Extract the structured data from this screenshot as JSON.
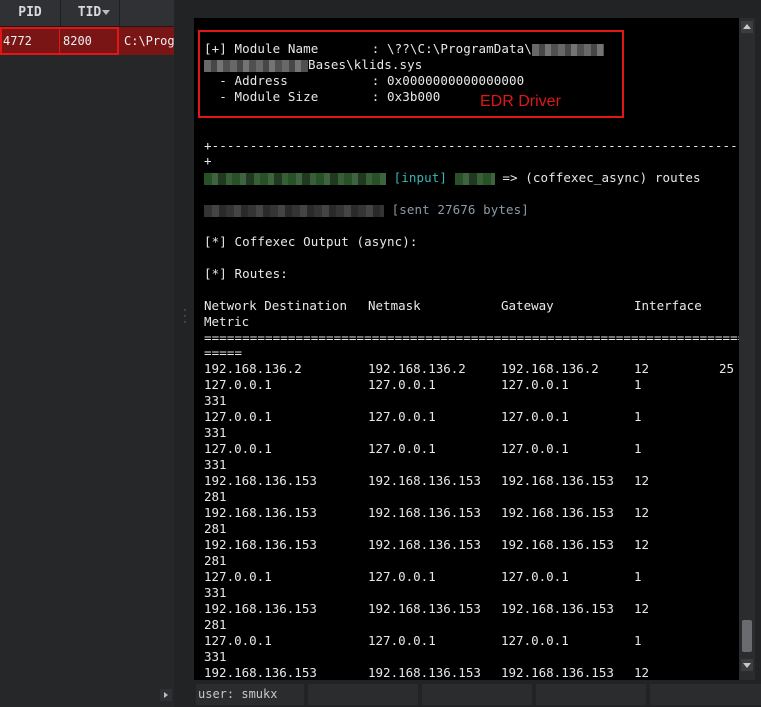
{
  "process_table": {
    "columns": [
      "PID",
      "TID"
    ],
    "row": {
      "pid": "4772",
      "tid": "8200",
      "path": "C:\\Prog"
    }
  },
  "terminal": {
    "module": {
      "name_line": "[+] Module Name       : \\??\\C:\\ProgramData\\",
      "name_line2": "Bases\\klids.sys",
      "address_line": "  - Address           : 0x0000000000000000",
      "size_line": "  - Module Size       : 0x3b000",
      "annotation": "EDR Driver"
    },
    "separator_line": "+---------------------------------------------------------------------",
    "separator_end": "+",
    "input_tag": "[input]",
    "command": "=> (coffexec_async) routes",
    "sent": "[sent 27676 bytes]",
    "coffexec_output": "[*] Coffexec Output (async):",
    "routes_header": "[*] Routes:",
    "table_headers": {
      "destination": "Network Destination",
      "netmask": "Netmask",
      "gateway": "Gateway",
      "interface": "Interface",
      "metric": "Metric"
    },
    "equals_line": "=======================================================================",
    "equals_end": "=====",
    "routes": [
      {
        "dest": "192.168.136.2",
        "mask": "192.168.136.2",
        "gw": "192.168.136.2",
        "iface": "12",
        "metric": "25"
      },
      {
        "dest": "127.0.0.1",
        "mask": "127.0.0.1",
        "gw": "127.0.0.1",
        "iface": "1",
        "metric": "331"
      },
      {
        "dest": "127.0.0.1",
        "mask": "127.0.0.1",
        "gw": "127.0.0.1",
        "iface": "1",
        "metric": "331"
      },
      {
        "dest": "127.0.0.1",
        "mask": "127.0.0.1",
        "gw": "127.0.0.1",
        "iface": "1",
        "metric": "331"
      },
      {
        "dest": "192.168.136.153",
        "mask": "192.168.136.153",
        "gw": "192.168.136.153",
        "iface": "12",
        "metric": "281"
      },
      {
        "dest": "192.168.136.153",
        "mask": "192.168.136.153",
        "gw": "192.168.136.153",
        "iface": "12",
        "metric": "281"
      },
      {
        "dest": "192.168.136.153",
        "mask": "192.168.136.153",
        "gw": "192.168.136.153",
        "iface": "12",
        "metric": "281"
      },
      {
        "dest": "127.0.0.1",
        "mask": "127.0.0.1",
        "gw": "127.0.0.1",
        "iface": "1",
        "metric": "331"
      },
      {
        "dest": "192.168.136.153",
        "mask": "192.168.136.153",
        "gw": "192.168.136.153",
        "iface": "12",
        "metric": "281"
      },
      {
        "dest": "127.0.0.1",
        "mask": "127.0.0.1",
        "gw": "127.0.0.1",
        "iface": "1",
        "metric": "331"
      },
      {
        "dest": "192.168.136.153",
        "mask": "192.168.136.153",
        "gw": "192.168.136.153",
        "iface": "12",
        "metric": ""
      }
    ]
  },
  "statusbar": {
    "user": "user: smukx"
  },
  "colors": {
    "highlight_red": "#e01717",
    "row_bg": "#7a1516",
    "input_tag": "#36b7b7"
  },
  "icons": [
    "sort-arrow-icon",
    "expand-arrow-icon",
    "scroll-up-icon",
    "scroll-down-icon",
    "splitter-grip-icon"
  ]
}
